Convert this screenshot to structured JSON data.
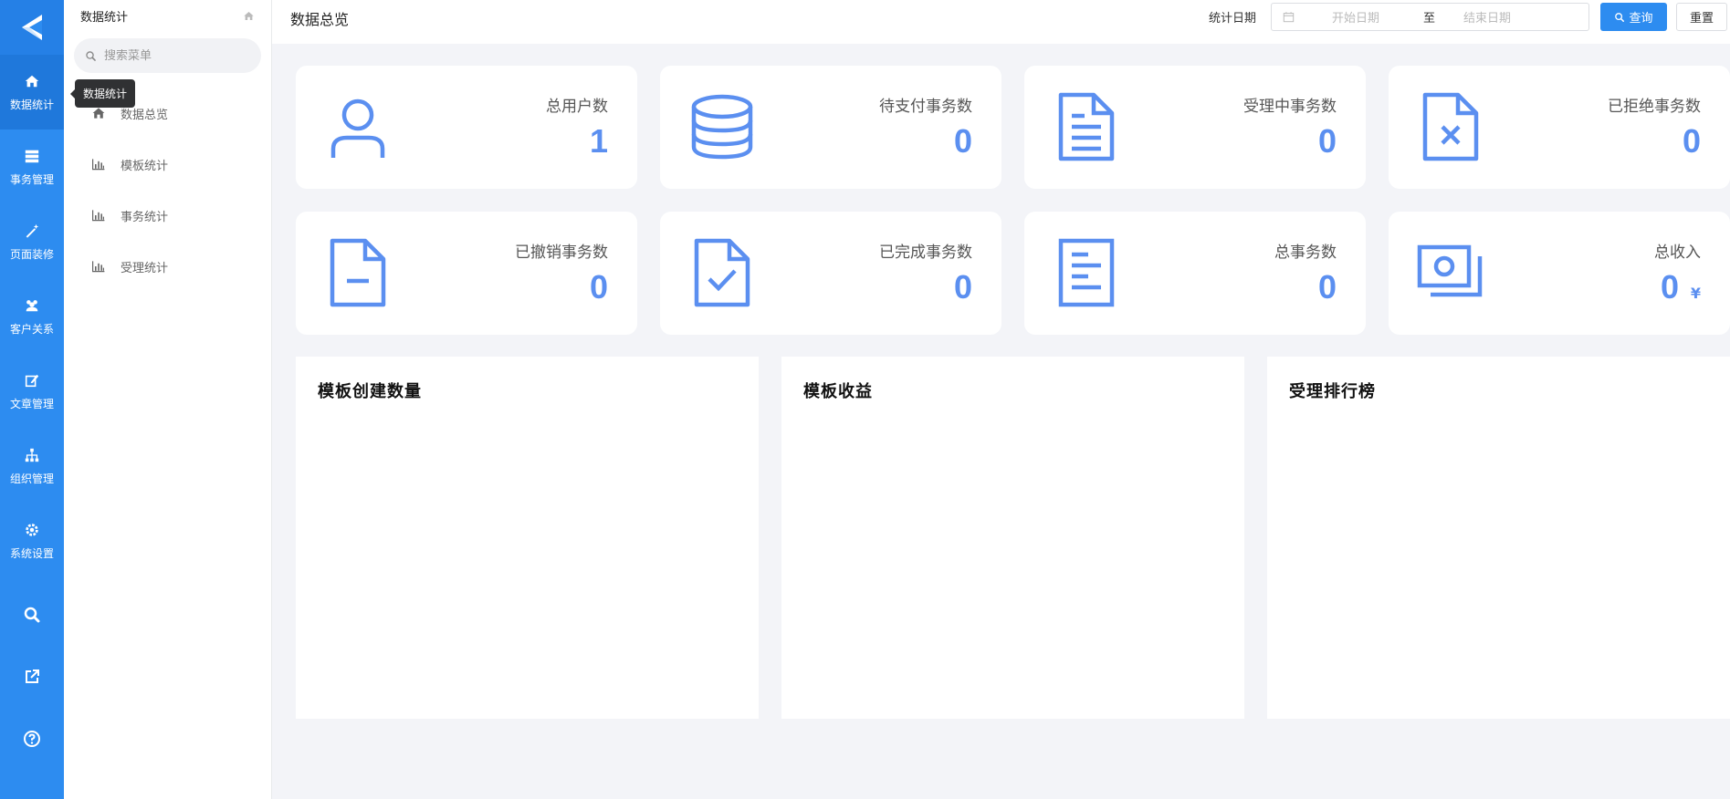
{
  "rail": {
    "items": [
      {
        "label": "数据统计",
        "icon": "home-icon"
      },
      {
        "label": "事务管理",
        "icon": "server-icon"
      },
      {
        "label": "页面装修",
        "icon": "magic-wand-icon"
      },
      {
        "label": "客户关系",
        "icon": "users-icon"
      },
      {
        "label": "文章管理",
        "icon": "edit-icon"
      },
      {
        "label": "组织管理",
        "icon": "sitemap-icon"
      },
      {
        "label": "系统设置",
        "icon": "gear-icon"
      }
    ],
    "tools": [
      "search-icon",
      "external-link-icon",
      "help-icon"
    ]
  },
  "tooltip": "数据统计",
  "submenu": {
    "title": "数据统计",
    "search_placeholder": "搜索菜单",
    "items": [
      {
        "label": "数据总览",
        "icon": "home-icon"
      },
      {
        "label": "模板统计",
        "icon": "bar-chart-icon"
      },
      {
        "label": "事务统计",
        "icon": "bar-chart-icon"
      },
      {
        "label": "受理统计",
        "icon": "bar-chart-icon"
      }
    ]
  },
  "header": {
    "title": "数据总览",
    "date_label": "统计日期",
    "start_placeholder": "开始日期",
    "separator": "至",
    "end_placeholder": "结束日期",
    "query_label": "查询",
    "reset_label": "重置"
  },
  "stats": [
    {
      "label": "总用户数",
      "value": "1",
      "icon": "user-icon"
    },
    {
      "label": "待支付事务数",
      "value": "0",
      "icon": "database-icon"
    },
    {
      "label": "受理中事务数",
      "value": "0",
      "icon": "file-text-icon"
    },
    {
      "label": "已拒绝事务数",
      "value": "0",
      "icon": "file-x-icon"
    },
    {
      "label": "已撤销事务数",
      "value": "0",
      "icon": "file-minus-icon"
    },
    {
      "label": "已完成事务数",
      "value": "0",
      "icon": "file-check-icon"
    },
    {
      "label": "总事务数",
      "value": "0",
      "icon": "file-lines-icon"
    },
    {
      "label": "总收入",
      "value": "0",
      "unit": "¥",
      "icon": "money-icon"
    }
  ],
  "panels": [
    {
      "title": "模板创建数量"
    },
    {
      "title": "模板收益"
    },
    {
      "title": "受理排行榜"
    }
  ],
  "colors": {
    "primary": "#2d8cf0",
    "stat_value": "#5b8ff0",
    "background": "#f3f4f8"
  }
}
